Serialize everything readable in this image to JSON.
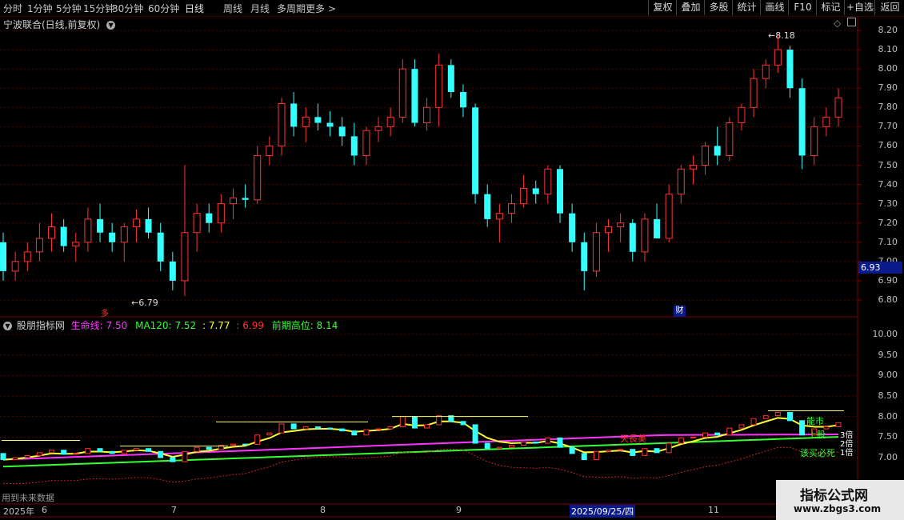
{
  "toolbar": {
    "periods": [
      "分时",
      "1分钟",
      "5分钟",
      "15分钟",
      "30分钟",
      "60分钟",
      "日线",
      "周线",
      "月线",
      "多周期",
      "更多 >"
    ],
    "active_period": "日线",
    "right_buttons": [
      "复权",
      "叠加",
      "多股",
      "统计",
      "画线",
      "F10",
      "标记",
      "+自选",
      "返回"
    ]
  },
  "main_chart": {
    "stock_title": "宁波联合(日线,前复权)",
    "y_ticks": [
      "8.20",
      "8.10",
      "8.00",
      "7.90",
      "7.80",
      "7.70",
      "7.60",
      "7.50",
      "7.40",
      "7.30",
      "7.20",
      "7.10",
      "7.00",
      "6.90",
      "6.80"
    ],
    "current_price": "6.93",
    "high_label": "8.18",
    "low_label": "6.79",
    "marker_cai": "财",
    "marker_left": "多"
  },
  "indicator": {
    "name": "股朋指标网",
    "lifeline_label": "生命线:",
    "lifeline_value": "7.50",
    "ma120_label": "MA120:",
    "ma120_value": "7.52",
    "v3": ": 7.77",
    "v4": ": 6.99",
    "prev_high_label": "前期高位:",
    "prev_high_value": "8.14",
    "y_ticks": [
      "10.00",
      "9.50",
      "9.00",
      "8.50",
      "8.00",
      "7.50",
      "7.00"
    ],
    "annotations": {
      "tianchang": "天長美",
      "lucky": "能市",
      "up": "上股",
      "buy": "该买必死",
      "x3": "3倍",
      "x2": "2倍",
      "x1": "1倍"
    },
    "footer_note": "用到未来数据",
    "colors": {
      "lifeline": "#ff33ff",
      "ma120": "#33ff33",
      "yellow": "#ffff33",
      "dashed": "#cc2222"
    }
  },
  "x_axis": {
    "labels": [
      "2025年",
      "6",
      "7",
      "8",
      "9",
      "2025/09/25/四",
      "11"
    ]
  },
  "watermark": {
    "title": "指标公式网",
    "url": "www.zbgs3.com"
  },
  "chart_data": {
    "type": "candlestick",
    "title": "宁波联合(日线,前复权)",
    "ylim": [
      6.75,
      8.25
    ],
    "candles": [
      [
        7.1,
        7.15,
        6.9,
        6.95
      ],
      [
        6.95,
        7.05,
        6.9,
        7.0
      ],
      [
        7.0,
        7.1,
        6.95,
        7.05
      ],
      [
        7.05,
        7.2,
        7.0,
        7.12
      ],
      [
        7.12,
        7.25,
        7.05,
        7.18
      ],
      [
        7.18,
        7.22,
        7.05,
        7.08
      ],
      [
        7.08,
        7.15,
        7.0,
        7.1
      ],
      [
        7.1,
        7.28,
        7.05,
        7.22
      ],
      [
        7.22,
        7.3,
        7.1,
        7.15
      ],
      [
        7.15,
        7.2,
        7.05,
        7.1
      ],
      [
        7.1,
        7.2,
        7.0,
        7.18
      ],
      [
        7.18,
        7.27,
        7.1,
        7.22
      ],
      [
        7.22,
        7.28,
        7.12,
        7.15
      ],
      [
        7.15,
        7.2,
        6.95,
        7.0
      ],
      [
        7.0,
        7.05,
        6.85,
        6.9
      ],
      [
        6.9,
        7.5,
        6.82,
        7.15
      ],
      [
        7.15,
        7.3,
        7.05,
        7.25
      ],
      [
        7.25,
        7.3,
        7.15,
        7.2
      ],
      [
        7.2,
        7.35,
        7.15,
        7.3
      ],
      [
        7.3,
        7.38,
        7.22,
        7.33
      ],
      [
        7.33,
        7.4,
        7.28,
        7.32
      ],
      [
        7.32,
        7.6,
        7.3,
        7.55
      ],
      [
        7.55,
        7.65,
        7.5,
        7.6
      ],
      [
        7.6,
        7.85,
        7.55,
        7.82
      ],
      [
        7.82,
        7.88,
        7.65,
        7.7
      ],
      [
        7.7,
        7.8,
        7.62,
        7.75
      ],
      [
        7.75,
        7.82,
        7.68,
        7.72
      ],
      [
        7.72,
        7.78,
        7.65,
        7.7
      ],
      [
        7.7,
        7.75,
        7.6,
        7.65
      ],
      [
        7.65,
        7.72,
        7.5,
        7.55
      ],
      [
        7.55,
        7.7,
        7.5,
        7.68
      ],
      [
        7.68,
        7.75,
        7.62,
        7.7
      ],
      [
        7.7,
        7.8,
        7.65,
        7.75
      ],
      [
        7.75,
        8.05,
        7.72,
        8.0
      ],
      [
        8.0,
        8.05,
        7.7,
        7.72
      ],
      [
        7.72,
        7.85,
        7.68,
        7.8
      ],
      [
        7.8,
        8.08,
        7.7,
        8.02
      ],
      [
        8.02,
        8.05,
        7.85,
        7.88
      ],
      [
        7.88,
        7.92,
        7.75,
        7.8
      ],
      [
        7.8,
        7.82,
        7.3,
        7.35
      ],
      [
        7.35,
        7.4,
        7.18,
        7.22
      ],
      [
        7.22,
        7.3,
        7.1,
        7.25
      ],
      [
        7.25,
        7.35,
        7.2,
        7.3
      ],
      [
        7.3,
        7.45,
        7.28,
        7.38
      ],
      [
        7.38,
        7.42,
        7.3,
        7.35
      ],
      [
        7.35,
        7.5,
        7.3,
        7.48
      ],
      [
        7.48,
        7.5,
        7.2,
        7.25
      ],
      [
        7.25,
        7.3,
        7.05,
        7.1
      ],
      [
        7.1,
        7.15,
        6.85,
        6.95
      ],
      [
        6.95,
        7.2,
        6.92,
        7.15
      ],
      [
        7.15,
        7.22,
        7.05,
        7.18
      ],
      [
        7.18,
        7.25,
        7.1,
        7.2
      ],
      [
        7.2,
        7.22,
        7.0,
        7.05
      ],
      [
        7.05,
        7.25,
        7.0,
        7.22
      ],
      [
        7.22,
        7.3,
        7.15,
        7.12
      ],
      [
        7.12,
        7.4,
        7.1,
        7.35
      ],
      [
        7.35,
        7.5,
        7.3,
        7.48
      ],
      [
        7.48,
        7.55,
        7.4,
        7.5
      ],
      [
        7.5,
        7.62,
        7.45,
        7.6
      ],
      [
        7.6,
        7.7,
        7.5,
        7.55
      ],
      [
        7.55,
        7.75,
        7.52,
        7.72
      ],
      [
        7.72,
        7.82,
        7.68,
        7.8
      ],
      [
        7.8,
        8.0,
        7.75,
        7.95
      ],
      [
        7.95,
        8.05,
        7.9,
        8.02
      ],
      [
        8.02,
        8.18,
        7.98,
        8.1
      ],
      [
        8.1,
        8.12,
        7.85,
        7.9
      ],
      [
        7.9,
        7.95,
        7.48,
        7.55
      ],
      [
        7.55,
        7.75,
        7.5,
        7.7
      ],
      [
        7.7,
        7.8,
        7.65,
        7.75
      ],
      [
        7.75,
        7.9,
        7.7,
        7.85
      ]
    ]
  }
}
